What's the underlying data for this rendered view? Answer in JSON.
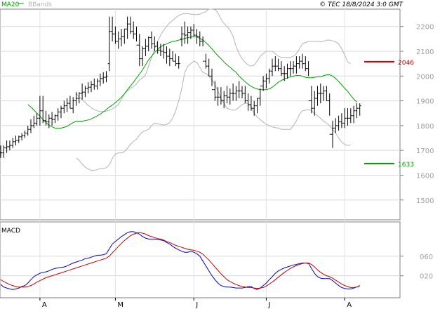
{
  "header": {
    "copyright": "© TEC 18/8/2024 3:0 GMT"
  },
  "legend": [
    {
      "label": "MA20",
      "color": "#00a000"
    },
    {
      "label": "BBands",
      "color": "#b4b4b4"
    }
  ],
  "macd_panel": {
    "title": "MACD",
    "ylim": [
      -0.25,
      1.3
    ],
    "ticks": [
      {
        "value": 0.2,
        "label": "020"
      },
      {
        "value": 0.6,
        "label": "060"
      }
    ],
    "macd_color": "#0000cc",
    "signal_color": "#cc0000"
  },
  "months": [
    "A",
    "M",
    "J",
    "J",
    "A"
  ],
  "chart_data": {
    "type": "ohlc",
    "ylim": [
      1420,
      2270
    ],
    "yticks": [
      1500,
      1600,
      1700,
      1800,
      1900,
      2000,
      2100,
      2200
    ],
    "ytick_labels": [
      "1500",
      "1600",
      "1700",
      "1800",
      "1900",
      "2000",
      "2100",
      "2200"
    ],
    "month_start_bars": [
      13,
      38,
      64,
      88,
      114
    ],
    "levels": [
      {
        "label": "2046",
        "value": 2058,
        "color": "#cc0000"
      },
      {
        "label": "1633",
        "value": 1647,
        "color": "#009900"
      }
    ],
    "series": [
      {
        "name": "MA20",
        "color": "#00a000",
        "values": [
          1885,
          1875,
          1863,
          1850,
          1838,
          1825,
          1812,
          1802,
          1795,
          1790,
          1790,
          1790,
          1793,
          1797,
          1805,
          1812,
          1818,
          1818,
          1818,
          1820,
          1823,
          1827,
          1833,
          1840,
          1847,
          1855,
          1865,
          1875,
          1883,
          1893,
          1903,
          1915,
          1928,
          1945,
          1960,
          1975,
          1992,
          2008,
          2025,
          2045,
          2065,
          2080,
          2095,
          2108,
          2118,
          2125,
          2130,
          2135,
          2140,
          2142,
          2145,
          2148,
          2152,
          2155,
          2157,
          2160,
          2158,
          2152,
          2145,
          2135,
          2123,
          2110,
          2095,
          2082,
          2070,
          2057,
          2045,
          2035,
          2025,
          2015,
          2000,
          1988,
          1977,
          1967,
          1958,
          1952,
          1948,
          1945,
          1945,
          1945,
          1948,
          1955,
          1965,
          1975,
          1982,
          1988,
          1993,
          1997,
          2000,
          2002,
          2002,
          2000,
          1995,
          1993,
          1993,
          1995,
          1997,
          1998,
          2001,
          2005,
          2005,
          2000,
          1990,
          1978,
          1965,
          1950,
          1938,
          1922,
          1907,
          1895
        ]
      },
      {
        "name": "BB upper",
        "color": "#b4b4b4",
        "values": [
          1930,
          1915,
          1905,
          1893,
          1882,
          1872,
          1865,
          1860,
          1857,
          1857,
          1859,
          1862,
          1868,
          1875,
          1885,
          1905,
          1928,
          1940,
          1950,
          1958,
          1968,
          1985,
          1992,
          2005,
          2040,
          2075,
          2110,
          2140,
          2165,
          2185,
          2200,
          2215,
          2225,
          2235,
          2245,
          2250,
          2252,
          2252,
          2250,
          2248,
          2248,
          2250,
          2255,
          2260,
          2270,
          2270,
          2268,
          2255,
          2230,
          2212,
          2200,
          2185,
          2160,
          2120,
          2090,
          2070,
          2055,
          2045,
          2040,
          2045,
          2060,
          2080,
          2090,
          2100,
          2100,
          2100,
          2090,
          2080,
          2075,
          2075,
          2075,
          2075,
          2080,
          2090,
          2110,
          2130,
          2135,
          2140,
          2140,
          2140,
          2140,
          2138,
          2140,
          2145,
          2145,
          2142,
          2138,
          2130,
          2110,
          2085,
          2057,
          2050
        ]
      },
      {
        "name": "BB lower",
        "color": "#b4b4b4",
        "values": [
          1670,
          1660,
          1645,
          1632,
          1625,
          1620,
          1620,
          1622,
          1627,
          1627,
          1630,
          1642,
          1668,
          1685,
          1690,
          1690,
          1695,
          1708,
          1725,
          1736,
          1745,
          1762,
          1775,
          1780,
          1785,
          1800,
          1810,
          1808,
          1805,
          1802,
          1805,
          1812,
          1830,
          1860,
          1900,
          1950,
          2015,
          2040,
          2050,
          2060,
          2055,
          2035,
          2015,
          2010,
          2000,
          1985,
          1965,
          1940,
          1910,
          1890,
          1870,
          1865,
          1862,
          1864,
          1874,
          1885,
          1890,
          1890,
          1872,
          1850,
          1835,
          1825,
          1815,
          1805,
          1800,
          1795,
          1792,
          1790,
          1785,
          1785,
          1785,
          1785,
          1800,
          1820,
          1845,
          1860,
          1862,
          1865,
          1860,
          1850,
          1840,
          1830,
          1817,
          1810,
          1800,
          1785,
          1770,
          1750,
          1734,
          1724,
          1720,
          1722
        ]
      },
      {
        "name": "Price",
        "color": "#000000",
        "open": [
          1690,
          1690,
          1710,
          1715,
          1720,
          1735,
          1740,
          1755,
          1760,
          1770,
          1785,
          1800,
          1810,
          1830,
          1860,
          1820,
          1815,
          1830,
          1825,
          1840,
          1855,
          1870,
          1880,
          1890,
          1870,
          1900,
          1910,
          1930,
          1935,
          1950,
          1955,
          1965,
          1960,
          1980,
          1990,
          1995,
          2050,
          2180,
          2170,
          2140,
          2150,
          2160,
          2190,
          2210,
          2180,
          2170,
          2125,
          2070,
          2110,
          2120,
          2155,
          2130,
          2120,
          2105,
          2100,
          2095,
          2080,
          2070,
          2060,
          2050,
          2150,
          2170,
          2165,
          2175,
          2185,
          2165,
          2160,
          2140,
          2060,
          2040,
          2000,
          1945,
          1915,
          1915,
          1900,
          1920,
          1915,
          1930,
          1930,
          1940,
          1940,
          1930,
          1900,
          1885,
          1870,
          1880,
          1910,
          1960,
          1980,
          1990,
          2020,
          2040,
          2040,
          2030,
          2010,
          2010,
          2030,
          2030,
          2040,
          2050,
          2060,
          2050,
          2030,
          1900,
          1870,
          1910,
          1930,
          1930,
          1940,
          1900,
          1765,
          1790,
          1800,
          1815,
          1810,
          1830,
          1830,
          1840,
          1860,
          1870
        ],
        "high": [
          1720,
          1720,
          1740,
          1740,
          1750,
          1760,
          1760,
          1770,
          1780,
          1800,
          1825,
          1840,
          1850,
          1920,
          1920,
          1860,
          1845,
          1855,
          1845,
          1870,
          1880,
          1900,
          1910,
          1920,
          1915,
          1935,
          1935,
          1970,
          1960,
          1975,
          1980,
          1990,
          1990,
          2010,
          2015,
          2020,
          2240,
          2240,
          2200,
          2180,
          2190,
          2190,
          2240,
          2240,
          2220,
          2200,
          2170,
          2120,
          2150,
          2160,
          2180,
          2160,
          2140,
          2130,
          2130,
          2120,
          2110,
          2100,
          2090,
          2080,
          2200,
          2220,
          2200,
          2200,
          2210,
          2190,
          2180,
          2160,
          2090,
          2070,
          2030,
          1980,
          1955,
          1955,
          1940,
          1960,
          1950,
          1970,
          1960,
          1980,
          1960,
          1960,
          1930,
          1920,
          1900,
          1910,
          1950,
          2000,
          2010,
          2030,
          2070,
          2080,
          2070,
          2060,
          2040,
          2050,
          2060,
          2060,
          2080,
          2080,
          2090,
          2080,
          2060,
          1960,
          1940,
          1960,
          1970,
          1960,
          1960,
          1930,
          1820,
          1830,
          1840,
          1850,
          1870,
          1870,
          1870,
          1880,
          1890,
          1890
        ],
        "low": [
          1670,
          1670,
          1690,
          1700,
          1710,
          1720,
          1730,
          1740,
          1750,
          1760,
          1770,
          1790,
          1800,
          1800,
          1810,
          1800,
          1790,
          1800,
          1810,
          1820,
          1830,
          1850,
          1855,
          1870,
          1850,
          1880,
          1890,
          1905,
          1915,
          1930,
          1935,
          1945,
          1945,
          1960,
          1970,
          1975,
          2020,
          2140,
          2130,
          2110,
          2120,
          2130,
          2150,
          2170,
          2150,
          2140,
          2040,
          2040,
          2080,
          2100,
          2110,
          2100,
          2090,
          2080,
          2070,
          2050,
          2040,
          2060,
          2040,
          2030,
          2120,
          2130,
          2130,
          2150,
          2160,
          2130,
          2120,
          2120,
          2030,
          2000,
          1960,
          1900,
          1880,
          1885,
          1870,
          1890,
          1885,
          1900,
          1900,
          1910,
          1910,
          1890,
          1860,
          1860,
          1840,
          1850,
          1880,
          1940,
          1950,
          1970,
          2000,
          2020,
          2020,
          2000,
          1980,
          1990,
          2000,
          2010,
          2010,
          2030,
          2030,
          2020,
          2000,
          1850,
          1840,
          1880,
          1890,
          1900,
          1900,
          1840,
          1710,
          1770,
          1780,
          1790,
          1790,
          1800,
          1810,
          1810,
          1830,
          1840
        ],
        "close": [
          1690,
          1710,
          1715,
          1720,
          1735,
          1740,
          1755,
          1760,
          1770,
          1785,
          1800,
          1810,
          1830,
          1860,
          1820,
          1815,
          1830,
          1825,
          1840,
          1855,
          1870,
          1880,
          1890,
          1870,
          1900,
          1910,
          1930,
          1935,
          1950,
          1955,
          1965,
          1960,
          1980,
          1990,
          1995,
          2000,
          2180,
          2170,
          2140,
          2150,
          2160,
          2190,
          2210,
          2180,
          2170,
          2125,
          2070,
          2110,
          2120,
          2155,
          2130,
          2120,
          2105,
          2100,
          2095,
          2080,
          2070,
          2060,
          2050,
          2050,
          2170,
          2165,
          2175,
          2185,
          2165,
          2160,
          2140,
          2060,
          2040,
          2000,
          1945,
          1915,
          1915,
          1900,
          1920,
          1915,
          1930,
          1930,
          1940,
          1940,
          1930,
          1900,
          1885,
          1870,
          1880,
          1910,
          1960,
          1980,
          1990,
          2020,
          2040,
          2040,
          2030,
          2010,
          2010,
          2030,
          2030,
          2040,
          2050,
          2060,
          2050,
          2030,
          1900,
          1870,
          1910,
          1930,
          1930,
          1940,
          1900,
          1765,
          1790,
          1800,
          1815,
          1810,
          1830,
          1830,
          1840,
          1860,
          1870,
          1880
        ]
      }
    ]
  },
  "macd_data": {
    "macd": [
      0.02,
      -0.03,
      -0.05,
      -0.07,
      -0.08,
      -0.07,
      -0.05,
      -0.02,
      0.0,
      0.05,
      0.12,
      0.18,
      0.22,
      0.25,
      0.27,
      0.28,
      0.3,
      0.33,
      0.35,
      0.36,
      0.37,
      0.38,
      0.4,
      0.43,
      0.46,
      0.48,
      0.5,
      0.52,
      0.55,
      0.56,
      0.58,
      0.6,
      0.62,
      0.62,
      0.63,
      0.65,
      0.75,
      0.85,
      0.9,
      0.95,
      1.0,
      1.04,
      1.08,
      1.1,
      1.1,
      1.08,
      1.05,
      1.0,
      0.97,
      0.95,
      0.95,
      0.95,
      0.94,
      0.93,
      0.92,
      0.88,
      0.85,
      0.8,
      0.76,
      0.73,
      0.7,
      0.68,
      0.68,
      0.7,
      0.68,
      0.65,
      0.6,
      0.5,
      0.4,
      0.3,
      0.2,
      0.12,
      0.05,
      0.0,
      -0.02,
      -0.03,
      -0.03,
      -0.04,
      -0.05,
      -0.05,
      -0.05,
      -0.04,
      -0.02,
      -0.02,
      -0.06,
      -0.08,
      -0.05,
      0.0,
      0.05,
      0.12,
      0.18,
      0.25,
      0.3,
      0.33,
      0.36,
      0.38,
      0.4,
      0.42,
      0.43,
      0.45,
      0.46,
      0.46,
      0.45,
      0.35,
      0.25,
      0.18,
      0.15,
      0.14,
      0.14,
      0.14,
      0.1,
      0.05,
      0.0,
      -0.04,
      -0.06,
      -0.07,
      -0.07,
      -0.05,
      -0.03,
      0.0
    ],
    "signal": [
      0.12,
      0.08,
      0.05,
      0.02,
      0.0,
      -0.02,
      -0.03,
      -0.03,
      -0.03,
      -0.02,
      0.0,
      0.03,
      0.07,
      0.1,
      0.13,
      0.16,
      0.18,
      0.2,
      0.22,
      0.24,
      0.26,
      0.28,
      0.3,
      0.32,
      0.34,
      0.36,
      0.38,
      0.4,
      0.42,
      0.44,
      0.46,
      0.48,
      0.5,
      0.52,
      0.54,
      0.56,
      0.6,
      0.67,
      0.73,
      0.8,
      0.86,
      0.92,
      0.97,
      1.02,
      1.05,
      1.07,
      1.08,
      1.07,
      1.05,
      1.02,
      1.0,
      0.98,
      0.96,
      0.95,
      0.93,
      0.9,
      0.88,
      0.85,
      0.82,
      0.8,
      0.78,
      0.76,
      0.74,
      0.73,
      0.72,
      0.7,
      0.68,
      0.64,
      0.58,
      0.52,
      0.45,
      0.38,
      0.31,
      0.24,
      0.18,
      0.12,
      0.08,
      0.05,
      0.02,
      0.0,
      -0.02,
      -0.03,
      -0.04,
      -0.04,
      -0.05,
      -0.06,
      -0.05,
      -0.04,
      -0.01,
      0.03,
      0.07,
      0.12,
      0.17,
      0.22,
      0.27,
      0.31,
      0.35,
      0.38,
      0.41,
      0.43,
      0.45,
      0.46,
      0.46,
      0.43,
      0.38,
      0.32,
      0.27,
      0.23,
      0.2,
      0.18,
      0.15,
      0.11,
      0.07,
      0.03,
      0.0,
      -0.02,
      -0.04,
      -0.04,
      -0.03,
      -0.01
    ]
  }
}
